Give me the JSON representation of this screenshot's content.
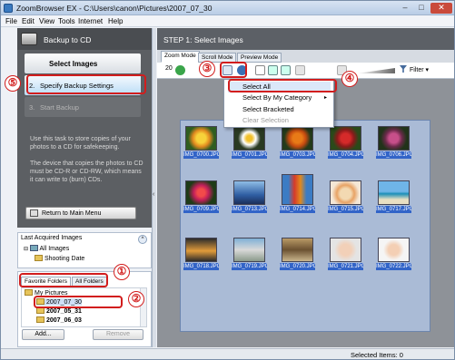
{
  "window": {
    "title": "ZoomBrowser EX  -  C:\\Users\\canon\\Pictures\\2007_07_30",
    "min": "–",
    "max": "□",
    "close": "✕"
  },
  "menu": [
    "File",
    "Edit",
    "View",
    "Tools",
    "Internet",
    "Help"
  ],
  "left": {
    "header": "Backup to CD",
    "steps": [
      {
        "num": "1.",
        "label": "Select Images"
      },
      {
        "num": "2.",
        "label": "Specify Backup Settings"
      },
      {
        "num": "3.",
        "label": "Start Backup"
      }
    ],
    "desc1": "Use this task to store copies of your photos to a CD for safekeeping.",
    "desc2": "The device that copies the photos to CD must be CD-R or CD-RW, which means it can write to (burn) CDs.",
    "return": "Return to Main Menu",
    "splitter_arrow": "‹"
  },
  "acquired": {
    "title": "Last Acquired Images",
    "collapse": "^",
    "items": [
      "All Images",
      "Shooting Date"
    ]
  },
  "folders": {
    "tabs": [
      "Favorite Folders",
      "All Folders"
    ],
    "tree": [
      "My Pictures",
      "2007_07_30",
      "2007_05_31",
      "2007_06_03"
    ],
    "add": "Add...",
    "remove": "Remove"
  },
  "right": {
    "header": "STEP 1: Select Images",
    "tabs": [
      "Zoom Mode",
      "Scroll Mode",
      "Preview Mode"
    ],
    "zoom_value": "20",
    "filter": "Filter",
    "menu_items": [
      "Select All",
      "Select By My Category",
      "Select Bracketed",
      "Clear Selection"
    ],
    "submenu_arrow": "▸"
  },
  "thumbnails": [
    "IMG_0700.JPG",
    "IMG_0701.JPG",
    "IMG_0703.JPG",
    "IMG_0704.JPG",
    "IMG_0706.JPG",
    "IMG_0709.JPG",
    "IMG_0713.JPG",
    "IMG_0714.JPG",
    "IMG_0715.JPG",
    "IMG_0717.JPG",
    "IMG_0718.JPG",
    "IMG_0719.JPG",
    "IMG_0720.JPG",
    "IMG_0721.JPG",
    "IMG_0722.JPG"
  ],
  "status": {
    "selected": "Selected Items: 0"
  },
  "callouts": [
    "①",
    "②",
    "③",
    "④",
    "⑤"
  ],
  "colors": {
    "accent_red": "#d21d1d",
    "selection_blue": "#3264c8",
    "step_highlight": "#b9dcf6"
  }
}
